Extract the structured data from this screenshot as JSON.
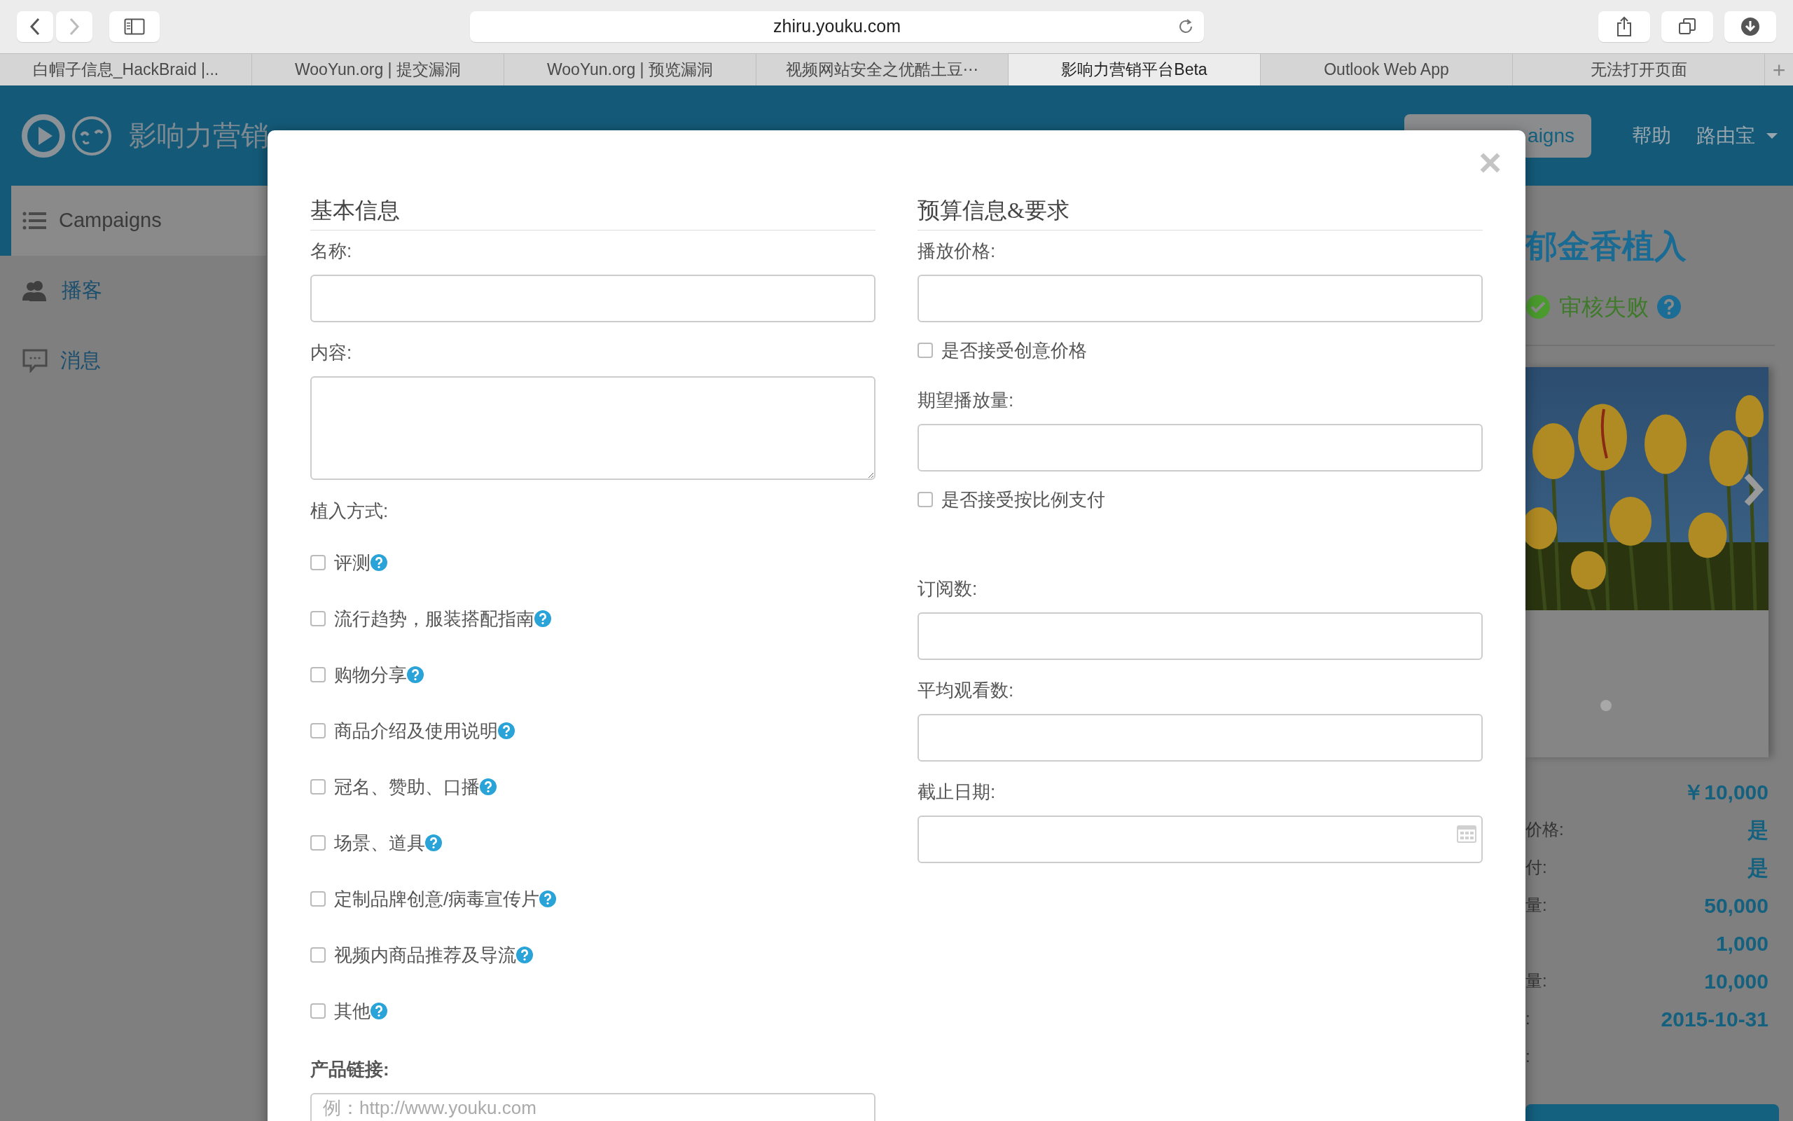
{
  "browser": {
    "back_enabled": true,
    "forward_enabled": false,
    "url": "zhiru.youku.com",
    "tabs": [
      {
        "label": "白帽子信息_HackBraid |...",
        "selected": false
      },
      {
        "label": "WooYun.org | 提交漏洞",
        "selected": false
      },
      {
        "label": "WooYun.org | 预览漏洞",
        "selected": false
      },
      {
        "label": "视频网站安全之优酷土豆⋯",
        "selected": false
      },
      {
        "label": "影响力营销平台Beta",
        "selected": true
      },
      {
        "label": "Outlook Web App",
        "selected": false
      },
      {
        "label": "无法打开页面",
        "selected": false
      }
    ],
    "new_tab": "+"
  },
  "header": {
    "title": "影响力营销",
    "create_button": "aigns",
    "nav": [
      "帮助"
    ],
    "user_menu": "路由宝"
  },
  "sidebar": {
    "items": [
      {
        "label": "Campaigns",
        "selected": true
      },
      {
        "label": "播客",
        "selected": false
      },
      {
        "label": "消息",
        "selected": false
      }
    ]
  },
  "campaign": {
    "title": "郁金香植入",
    "status": "审核失败",
    "details": [
      {
        "value": "￥10,000"
      },
      {
        "label": "价格:",
        "value": "是"
      },
      {
        "label": "付:",
        "value": "是"
      },
      {
        "label": "量:",
        "value": "50,000"
      },
      {
        "value": "1,000"
      },
      {
        "label": "量:",
        "value": "10,000"
      },
      {
        "label": ":",
        "value": "2015-10-31"
      },
      {
        "label": ":"
      }
    ]
  },
  "modal": {
    "close": "×",
    "columns": [
      {
        "heading": "基本信息",
        "fields": [
          {
            "kind": "input",
            "label": "名称:"
          },
          {
            "kind": "textarea",
            "label": "内容:"
          },
          {
            "kind": "checklist",
            "label": "植入方式:",
            "options": [
              {
                "label": "评测",
                "checked": false
              },
              {
                "label": "流行趋势，服装搭配指南",
                "checked": false
              },
              {
                "label": "购物分享",
                "checked": false
              },
              {
                "label": "商品介绍及使用说明",
                "checked": false
              },
              {
                "label": "冠名、赞助、口播",
                "checked": false
              },
              {
                "label": "场景、道具",
                "checked": false
              },
              {
                "label": "定制品牌创意/病毒宣传片",
                "checked": false
              },
              {
                "label": "视频内商品推荐及导流",
                "checked": false
              },
              {
                "label": "其他",
                "checked": false
              }
            ]
          },
          {
            "kind": "input",
            "label": "产品链接:",
            "bold": true,
            "placeholder": "例：http://www.youku.com"
          }
        ]
      },
      {
        "heading": "预算信息&要求",
        "fields": [
          {
            "kind": "input",
            "label": "播放价格:"
          },
          {
            "kind": "checkbox",
            "label": "是否接受创意价格",
            "checked": false
          },
          {
            "kind": "input",
            "label": "期望播放量:"
          },
          {
            "kind": "checkbox",
            "label": "是否接受按比例支付",
            "checked": false
          },
          {
            "kind": "input",
            "label": "订阅数:"
          },
          {
            "kind": "input",
            "label": "平均观看数:"
          },
          {
            "kind": "date",
            "label": "截止日期:"
          }
        ]
      }
    ]
  }
}
